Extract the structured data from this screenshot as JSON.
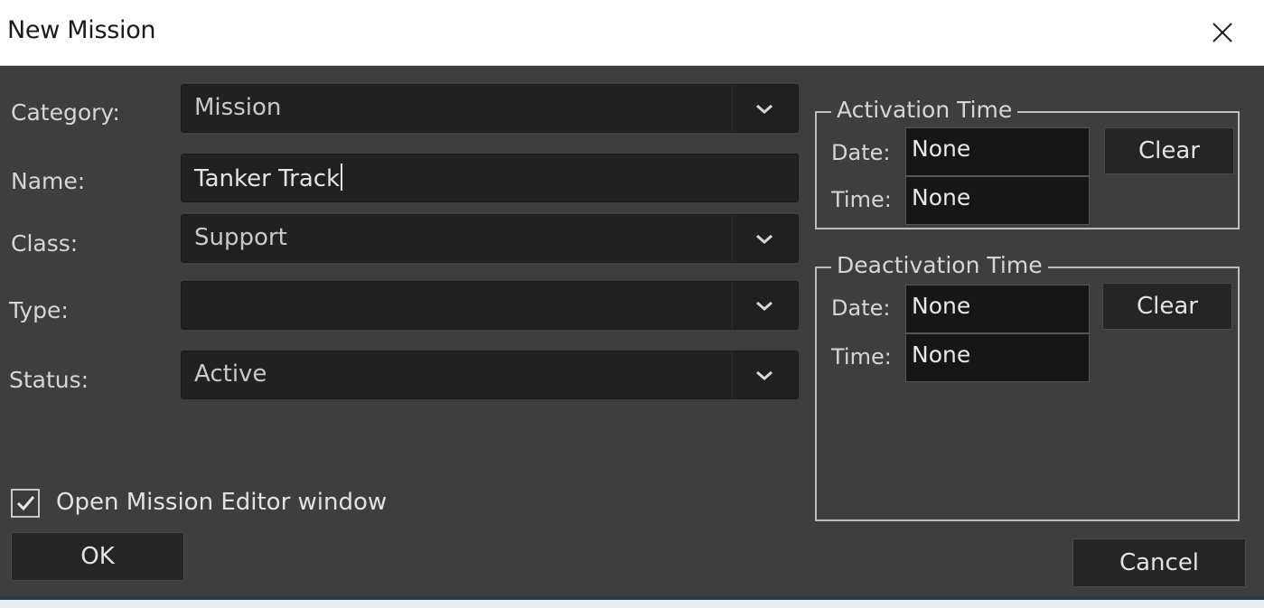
{
  "window": {
    "title": "New Mission",
    "close_icon": "close-icon"
  },
  "form": {
    "category": {
      "label": "Category:",
      "value": "Mission"
    },
    "name": {
      "label": "Name:",
      "value": "Tanker Track"
    },
    "class": {
      "label": "Class:",
      "value": "Support"
    },
    "type": {
      "label": "Type:",
      "value": ""
    },
    "status": {
      "label": "Status:",
      "value": "Active"
    }
  },
  "activation": {
    "title": "Activation Time",
    "date_label": "Date:",
    "date_value": "None",
    "time_label": "Time:",
    "time_value": "None",
    "clear_label": "Clear"
  },
  "deactivation": {
    "title": "Deactivation Time",
    "date_label": "Date:",
    "date_value": "None",
    "time_label": "Time:",
    "time_value": "None",
    "clear_label": "Clear"
  },
  "options": {
    "open_editor_label": "Open Mission Editor window",
    "open_editor_checked": true
  },
  "buttons": {
    "ok_label": "OK",
    "cancel_label": "Cancel"
  },
  "colors": {
    "background": "#3e3e3e",
    "field": "#212121",
    "text": "#d6d6d6",
    "titlebar": "#ffffff"
  }
}
